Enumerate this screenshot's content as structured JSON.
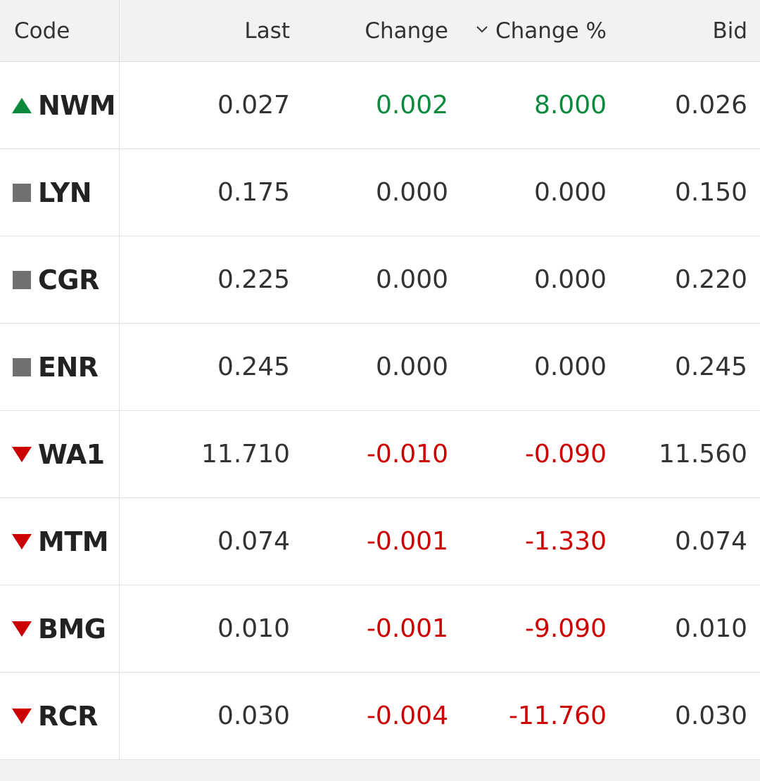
{
  "columns": {
    "code": "Code",
    "last": "Last",
    "change": "Change",
    "change_pct": "Change %",
    "bid": "Bid"
  },
  "colors": {
    "up": "#0a8a3c",
    "down": "#cc0000",
    "flat": "#707070"
  },
  "rows": [
    {
      "code": "NWM",
      "trend": "up",
      "last": "0.027",
      "change": "0.002",
      "change_pct": "8.000",
      "bid": "0.026"
    },
    {
      "code": "LYN",
      "trend": "flat",
      "last": "0.175",
      "change": "0.000",
      "change_pct": "0.000",
      "bid": "0.150"
    },
    {
      "code": "CGR",
      "trend": "flat",
      "last": "0.225",
      "change": "0.000",
      "change_pct": "0.000",
      "bid": "0.220"
    },
    {
      "code": "ENR",
      "trend": "flat",
      "last": "0.245",
      "change": "0.000",
      "change_pct": "0.000",
      "bid": "0.245"
    },
    {
      "code": "WA1",
      "trend": "down",
      "last": "11.710",
      "change": "-0.010",
      "change_pct": "-0.090",
      "bid": "11.560"
    },
    {
      "code": "MTM",
      "trend": "down",
      "last": "0.074",
      "change": "-0.001",
      "change_pct": "-1.330",
      "bid": "0.074"
    },
    {
      "code": "BMG",
      "trend": "down",
      "last": "0.010",
      "change": "-0.001",
      "change_pct": "-9.090",
      "bid": "0.010"
    },
    {
      "code": "RCR",
      "trend": "down",
      "last": "0.030",
      "change": "-0.004",
      "change_pct": "-11.760",
      "bid": "0.030"
    }
  ]
}
